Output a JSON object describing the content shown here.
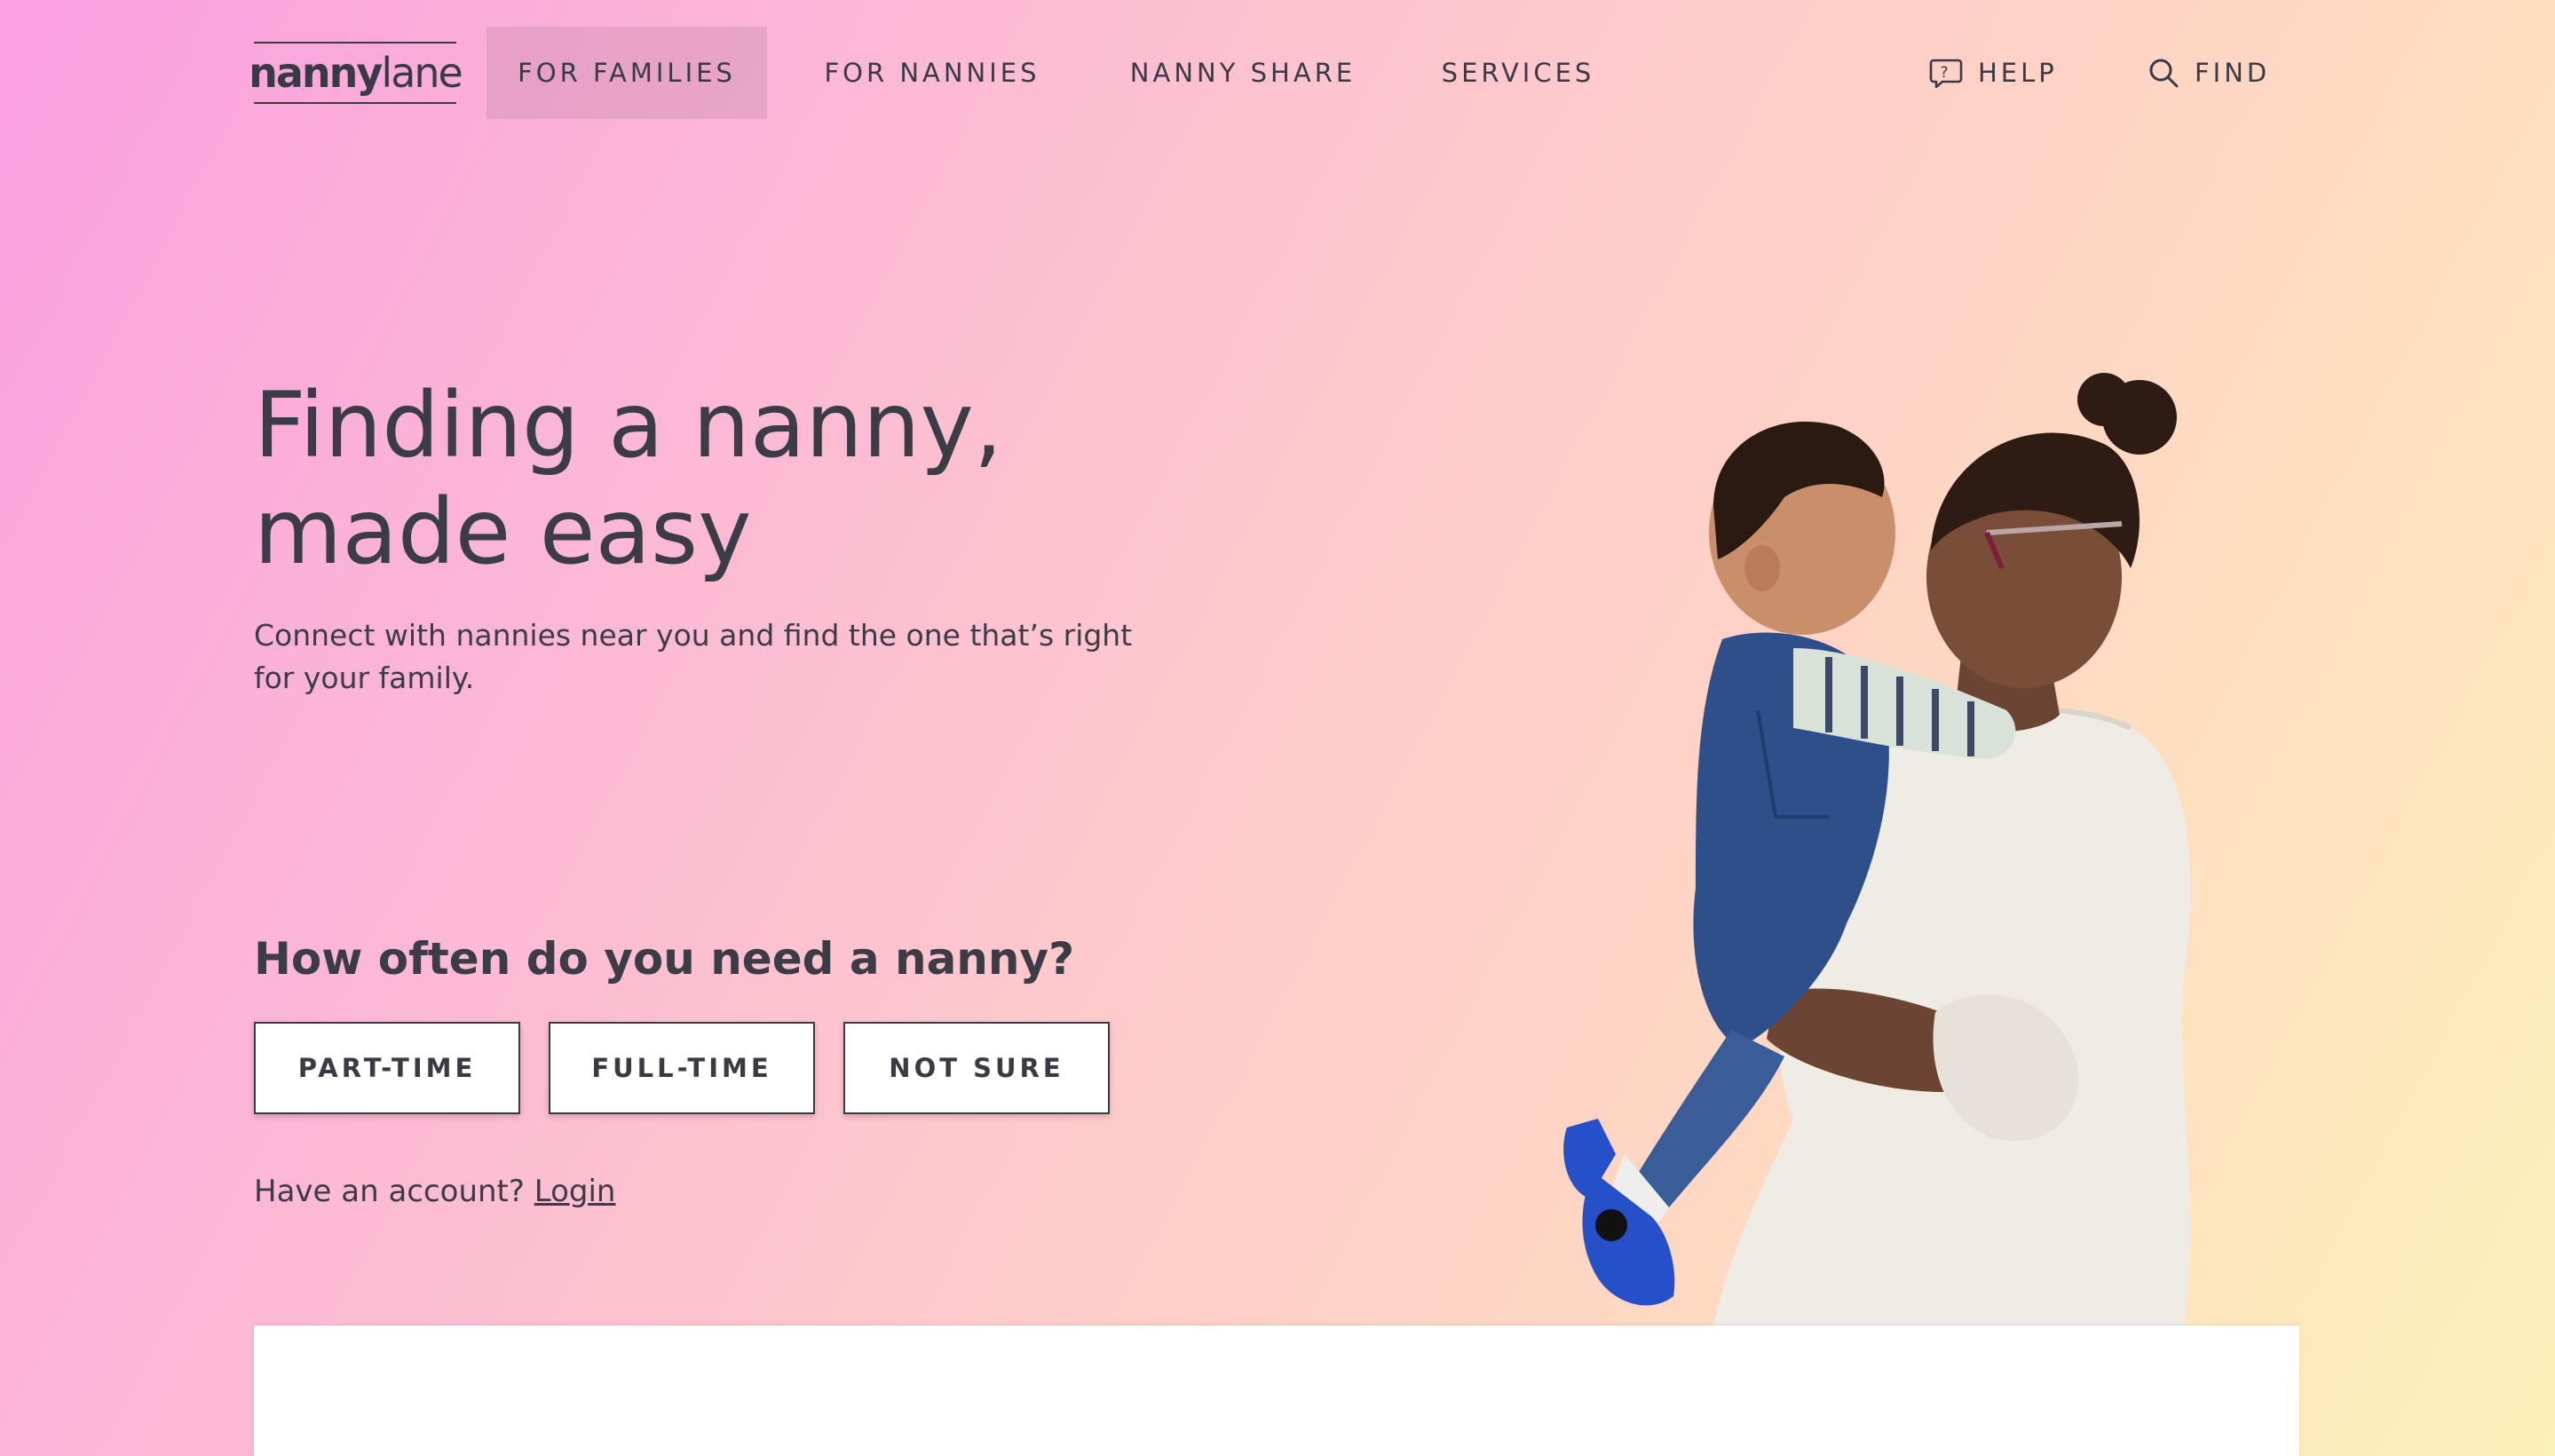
{
  "brand": {
    "logo_bold": "nanny",
    "logo_light": "lane"
  },
  "nav": {
    "items": [
      {
        "label": "FOR FAMILIES",
        "active": true
      },
      {
        "label": "FOR NANNIES",
        "active": false
      },
      {
        "label": "NANNY SHARE",
        "active": false
      },
      {
        "label": "SERVICES",
        "active": false
      }
    ],
    "help": {
      "label": "HELP",
      "icon": "help-bubble-icon"
    },
    "find": {
      "label": "FIND",
      "icon": "search-icon"
    }
  },
  "hero": {
    "title_line1": "Finding a nanny,",
    "title_line2": "made easy",
    "subtitle_line1": "Connect with nannies near you and find the one that’s right",
    "subtitle_line2": "for your family."
  },
  "frequency": {
    "question": "How often do you need a nanny?",
    "options": [
      "PART-TIME",
      "FULL-TIME",
      "NOT SURE"
    ]
  },
  "account": {
    "prompt": "Have an account?",
    "login_label": "Login"
  },
  "colors": {
    "text": "#3a3a44",
    "gradient_start": "#fb9fe1",
    "gradient_mid": "#fec9cc",
    "gradient_end": "#fcf1b8",
    "active_nav_bg": "#dba8c4"
  }
}
